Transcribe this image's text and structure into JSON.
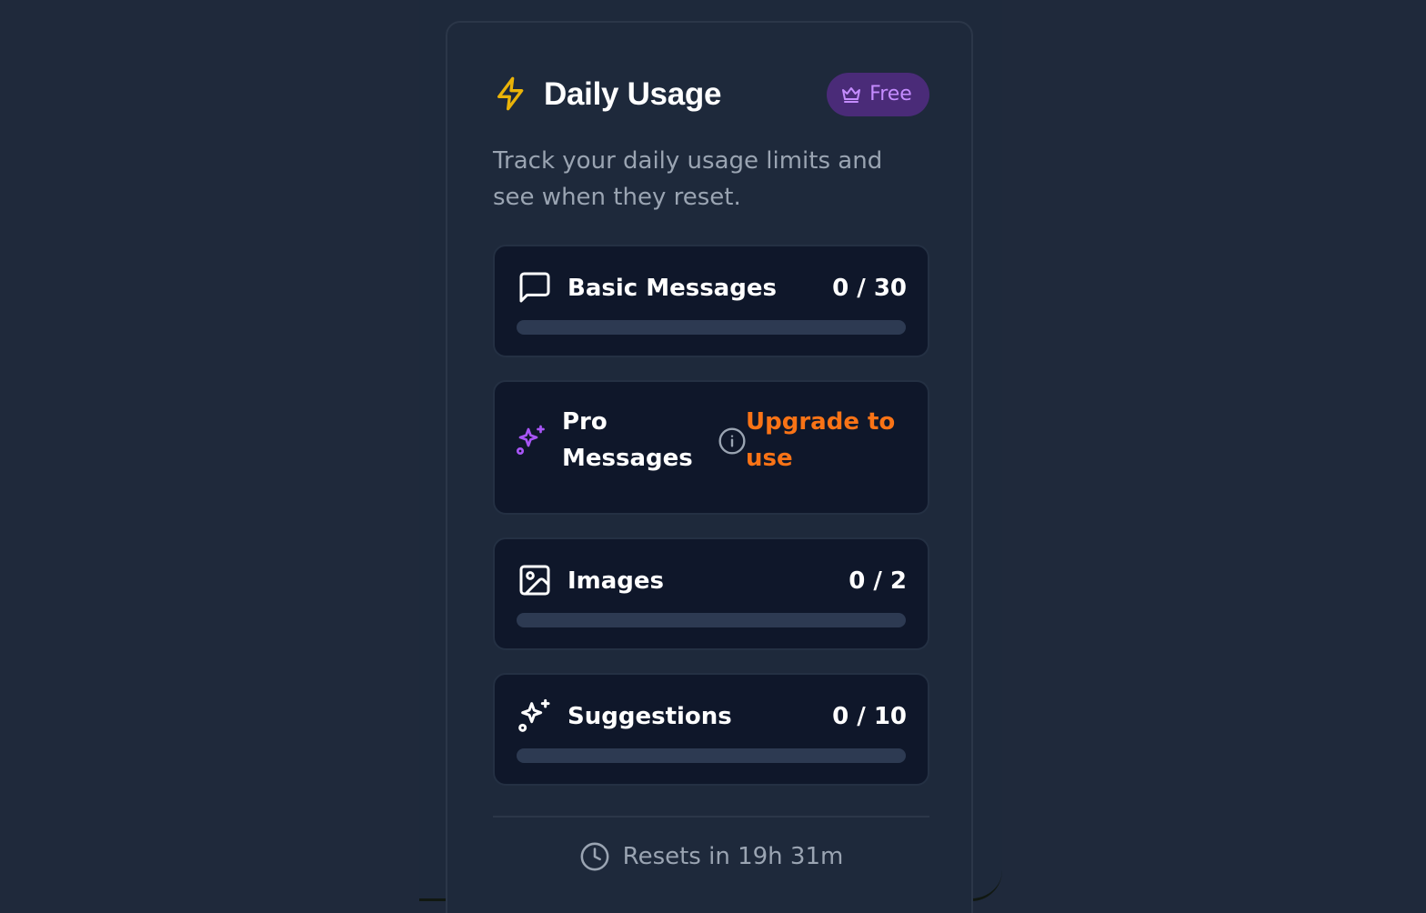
{
  "header": {
    "title": "Daily Usage",
    "icon": "bolt-icon",
    "plan_badge": {
      "label": "Free",
      "icon": "crown-icon"
    }
  },
  "description": "Track your daily usage limits and see when they reset.",
  "usage_items": [
    {
      "label": "Basic Messages",
      "icon": "message-square-icon",
      "count": "0 / 30",
      "used": 0,
      "limit": 30
    },
    {
      "label": "Pro Messages",
      "icon": "sparkles-icon",
      "action": "Upgrade to use",
      "info_icon": "info-icon"
    },
    {
      "label": "Images",
      "icon": "image-icon",
      "count": "0 / 2",
      "used": 0,
      "limit": 2
    },
    {
      "label": "Suggestions",
      "icon": "sparkles-icon",
      "count": "0 / 10",
      "used": 0,
      "limit": 10
    }
  ],
  "footer": {
    "reset_text": "Resets in 19h 31m",
    "icon": "clock-icon"
  },
  "colors": {
    "background": "#1f293b",
    "card": "#1e293b",
    "item_bg": "#0f172a",
    "accent_bolt": "#eab308",
    "badge_bg": "#4a2b78",
    "badge_text": "#c58cff",
    "upgrade": "#f97316",
    "pro_icon": "#a855f7",
    "progress_track": "#2d3a52"
  }
}
